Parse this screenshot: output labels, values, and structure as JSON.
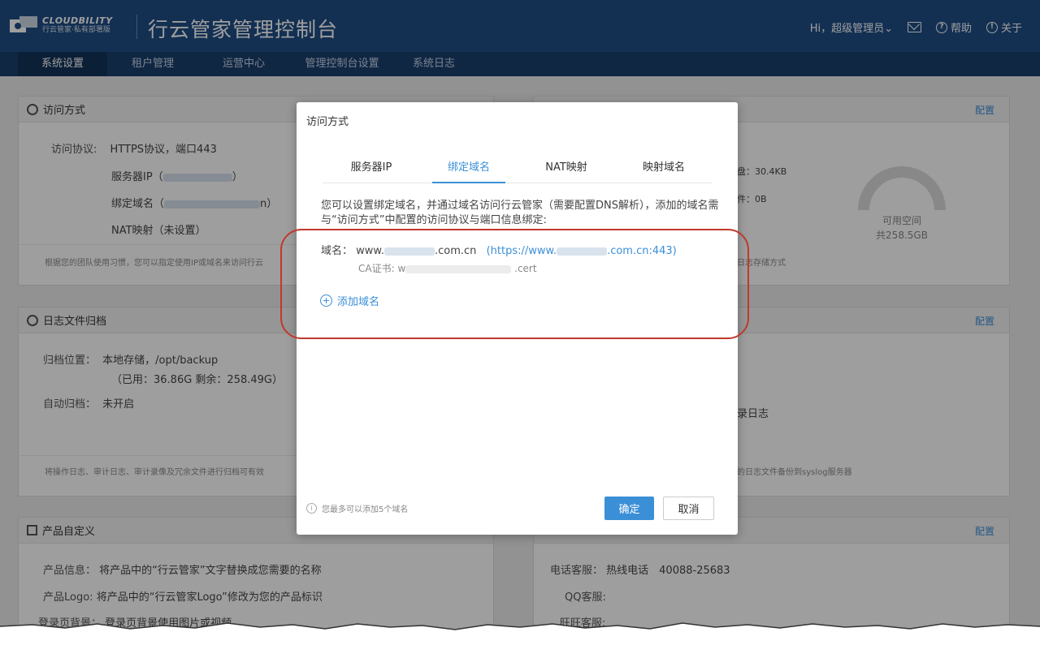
{
  "header": {
    "brand_en": "CLOUDBILITY",
    "brand_cn": "行云管家·私有部署版",
    "title": "行云管家管理控制台",
    "user": "Hi，超级管理员⌄",
    "help": "帮助",
    "about": "关于",
    "help_icon": "?",
    "about_icon": "!"
  },
  "nav": {
    "items": [
      {
        "label": "系统设置",
        "active": true
      },
      {
        "label": "租户管理"
      },
      {
        "label": "运营中心"
      },
      {
        "label": "管理控制台设置"
      },
      {
        "label": "系统日志"
      }
    ]
  },
  "access": {
    "title": "访问方式",
    "protocol_label": "访问协议:",
    "protocol_value": "HTTPS协议，端口443",
    "server_ip_prefix": "服务器IP（",
    "server_ip_suffix": "）",
    "domain_prefix": "绑定域名（",
    "domain_suffix": "n）",
    "nat": "NAT映射（未设置）",
    "note": "根据您的团队使用习惯，您可以指定使用IP或域名来访问行云"
  },
  "storage": {
    "config": "配置",
    "disk": "盘：30.4KB",
    "file": "件：0B",
    "gauge_label1": "可用空间",
    "gauge_label2": "共258.5GB",
    "note": "日志存储方式"
  },
  "archive": {
    "title": "日志文件归档",
    "location_label": "归档位置：",
    "location_value": "本地存储，/opt/backup",
    "usage": "（已用：36.86G 剩余：258.49G）",
    "auto_label": "自动归档：",
    "auto_value": "未开启",
    "note": "将操作日志、审计日志、审计录像及冗余文件进行归档可有效"
  },
  "syslog": {
    "config": "配置",
    "partial": "录日志",
    "note": "的日志文件备份到syslog服务器"
  },
  "product": {
    "title": "产品自定义",
    "info_label": "产品信息：",
    "info_value": "将产品中的“行云管家”文字替换成您需要的名称",
    "logo_label": "产品Logo:",
    "logo_value": "将产品中的“行云管家Logo”修改为您的产品标识",
    "bg_label": "登录页背景：",
    "bg_value": "登录页背景使用图片或视频"
  },
  "support": {
    "config": "配置",
    "phone_label": "电话客服：",
    "phone_value": "热线电话　40088-25683",
    "qq_label": "QQ客服:",
    "ww_label": "旺旺客服:"
  },
  "modal": {
    "title": "访问方式",
    "tabs": [
      {
        "label": "服务器IP"
      },
      {
        "label": "绑定域名",
        "active": true
      },
      {
        "label": "NAT映射"
      },
      {
        "label": "映射域名"
      }
    ],
    "description": "您可以设置绑定域名，并通过域名访问行云管家（需要配置DNS解析），添加的域名需与“访问方式”中配置的访问协议与端口信息绑定:",
    "domain_label": "域名：",
    "domain_prefix": "www.",
    "domain_suffix": ".com.cn",
    "link_prefix": "(https://www.",
    "link_suffix": ".com.cn:443)",
    "cert_label": "CA证书:",
    "cert_prefix": "w",
    "cert_suffix": ".cert",
    "add_domain": "添加域名",
    "footer_tip": "您最多可以添加5个域名",
    "ok": "确定",
    "cancel": "取消"
  },
  "colors": {
    "header": "#1f4e86",
    "accent": "#3b8fd7",
    "highlight": "#c0392b"
  }
}
